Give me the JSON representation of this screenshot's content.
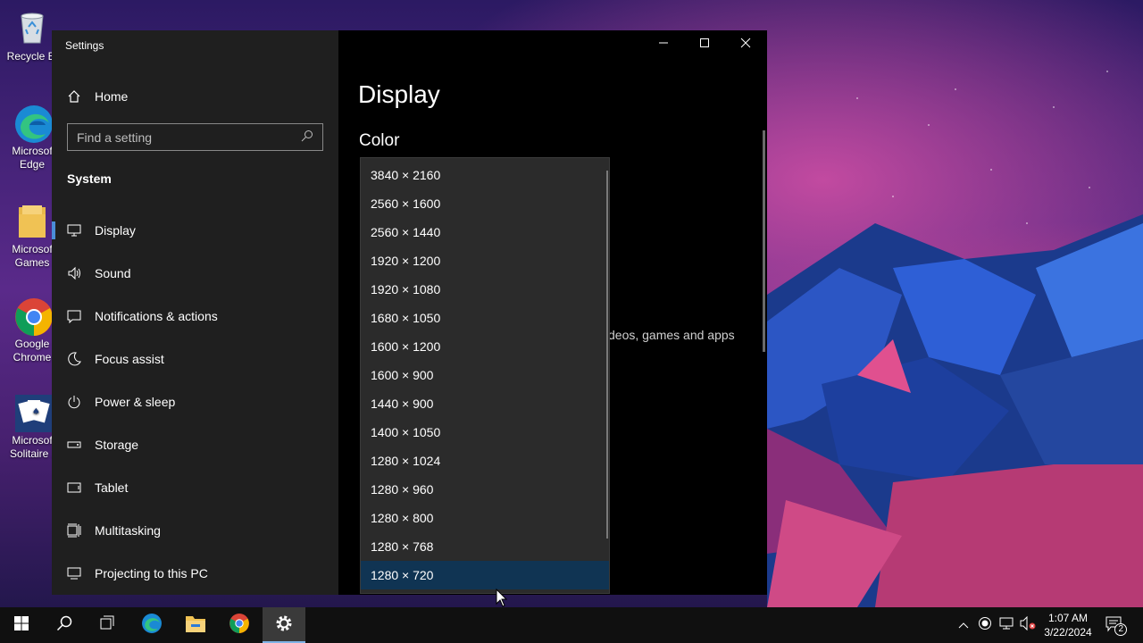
{
  "desktop": {
    "icons": [
      {
        "label": "Recycle Bi",
        "icon": "recycle-bin-icon"
      },
      {
        "label": "Microsof\nEdge",
        "icon": "edge-icon"
      },
      {
        "label": "Microsof\nGames",
        "icon": "folder-icon"
      },
      {
        "label": "Google\nChrome",
        "icon": "chrome-icon"
      },
      {
        "label": "Microsof\nSolitaire .",
        "icon": "solitaire-icon"
      }
    ]
  },
  "window": {
    "title": "Settings",
    "caption": {
      "minimize": "minimize-icon",
      "maximize": "maximize-icon",
      "close": "close-icon"
    }
  },
  "sidebar": {
    "home_label": "Home",
    "search_placeholder": "Find a setting",
    "section_label": "System",
    "items": [
      {
        "label": "Display",
        "icon": "monitor-icon",
        "active": true
      },
      {
        "label": "Sound",
        "icon": "speaker-icon"
      },
      {
        "label": "Notifications & actions",
        "icon": "notification-icon"
      },
      {
        "label": "Focus assist",
        "icon": "moon-icon"
      },
      {
        "label": "Power & sleep",
        "icon": "power-icon"
      },
      {
        "label": "Storage",
        "icon": "storage-icon"
      },
      {
        "label": "Tablet",
        "icon": "tablet-icon"
      },
      {
        "label": "Multitasking",
        "icon": "multitasking-icon"
      },
      {
        "label": "Projecting to this PC",
        "icon": "projecting-icon"
      }
    ]
  },
  "content": {
    "page_title": "Display",
    "section_title": "Color",
    "hint_text": "deos, games and apps"
  },
  "resolution_dropdown": {
    "options": [
      "3840 × 2160",
      "2560 × 1600",
      "2560 × 1440",
      "1920 × 1200",
      "1920 × 1080",
      "1680 × 1050",
      "1600 × 1200",
      "1600 × 900",
      "1440 × 900",
      "1400 × 1050",
      "1280 × 1024",
      "1280 × 960",
      "1280 × 800",
      "1280 × 768",
      "1280 × 720"
    ],
    "selected": "1280 × 720"
  },
  "taskbar": {
    "apps": [
      "start-icon",
      "search-icon",
      "task-view-icon",
      "edge-icon",
      "file-explorer-icon",
      "chrome-icon",
      "settings-icon"
    ],
    "active_app": "settings-icon",
    "time": "1:07 AM",
    "date": "3/22/2024",
    "notification_count": "2"
  },
  "colors": {
    "accent": "#4a8dd8",
    "selected_item": "#103453",
    "sidebar_bg": "#1f1f1f"
  }
}
